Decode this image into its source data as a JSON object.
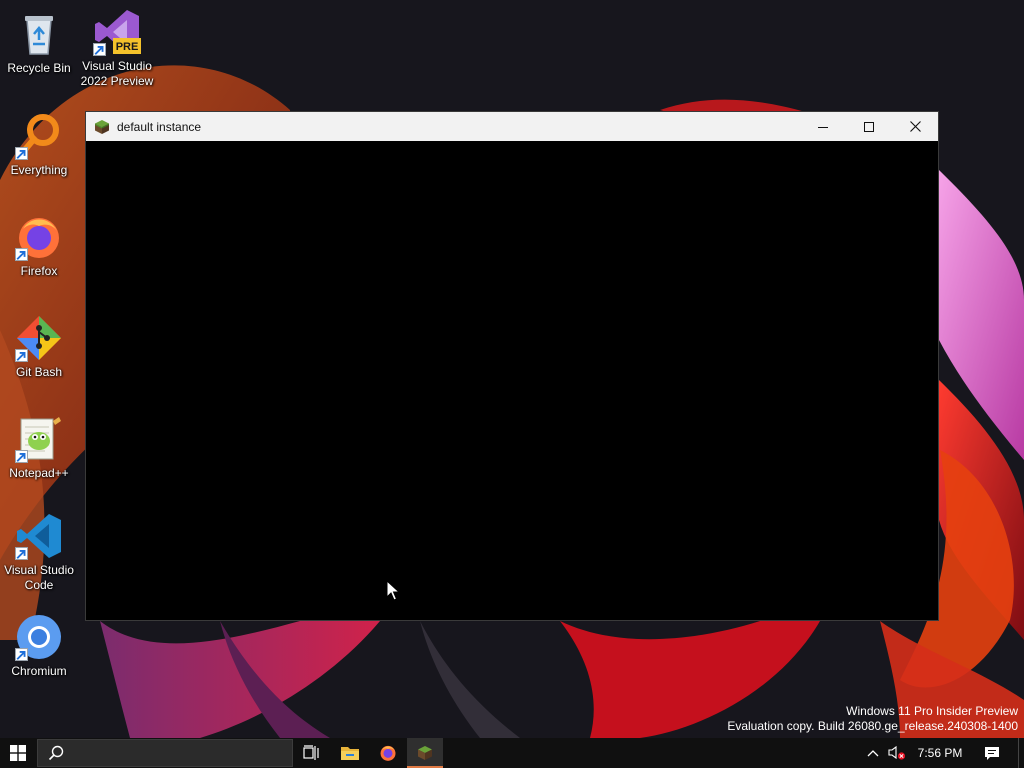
{
  "desktop": {
    "icons": [
      {
        "label": "Recycle Bin",
        "icon": "recycle-bin-icon"
      },
      {
        "label": "Visual Studio 2022 Preview",
        "icon": "visual-studio-preview-icon",
        "badge": "PRE"
      },
      {
        "label": "Everything",
        "icon": "everything-search-icon"
      },
      {
        "label": "Firefox",
        "icon": "firefox-icon"
      },
      {
        "label": "Git Bash",
        "icon": "git-bash-icon"
      },
      {
        "label": "Notepad++",
        "icon": "notepad-plus-plus-icon"
      },
      {
        "label": "Visual Studio Code",
        "icon": "vscode-icon"
      },
      {
        "label": "Chromium",
        "icon": "chromium-icon"
      }
    ]
  },
  "window": {
    "title": "default instance",
    "icon": "minecraft-grass-block-icon",
    "controls": [
      "minimize-icon",
      "maximize-icon",
      "close-icon"
    ]
  },
  "watermark": {
    "line1": "Windows 11 Pro Insider Preview",
    "line2": "Evaluation copy. Build 26080.ge_release.240308-1400"
  },
  "taskbar": {
    "items": [
      "windows-start-icon",
      "search-icon",
      "task-view-icon",
      "file-explorer-icon",
      "firefox-icon",
      "minecraft-icon"
    ],
    "tray": [
      "chevron-up-icon",
      "volume-muted-icon",
      "notification-icon"
    ],
    "clock": "7:56 PM"
  },
  "colors": {
    "window_client": "#000000",
    "titlebar": "#f2f2f2",
    "taskbar": "#101010",
    "active_indicator": "#e07a45"
  }
}
